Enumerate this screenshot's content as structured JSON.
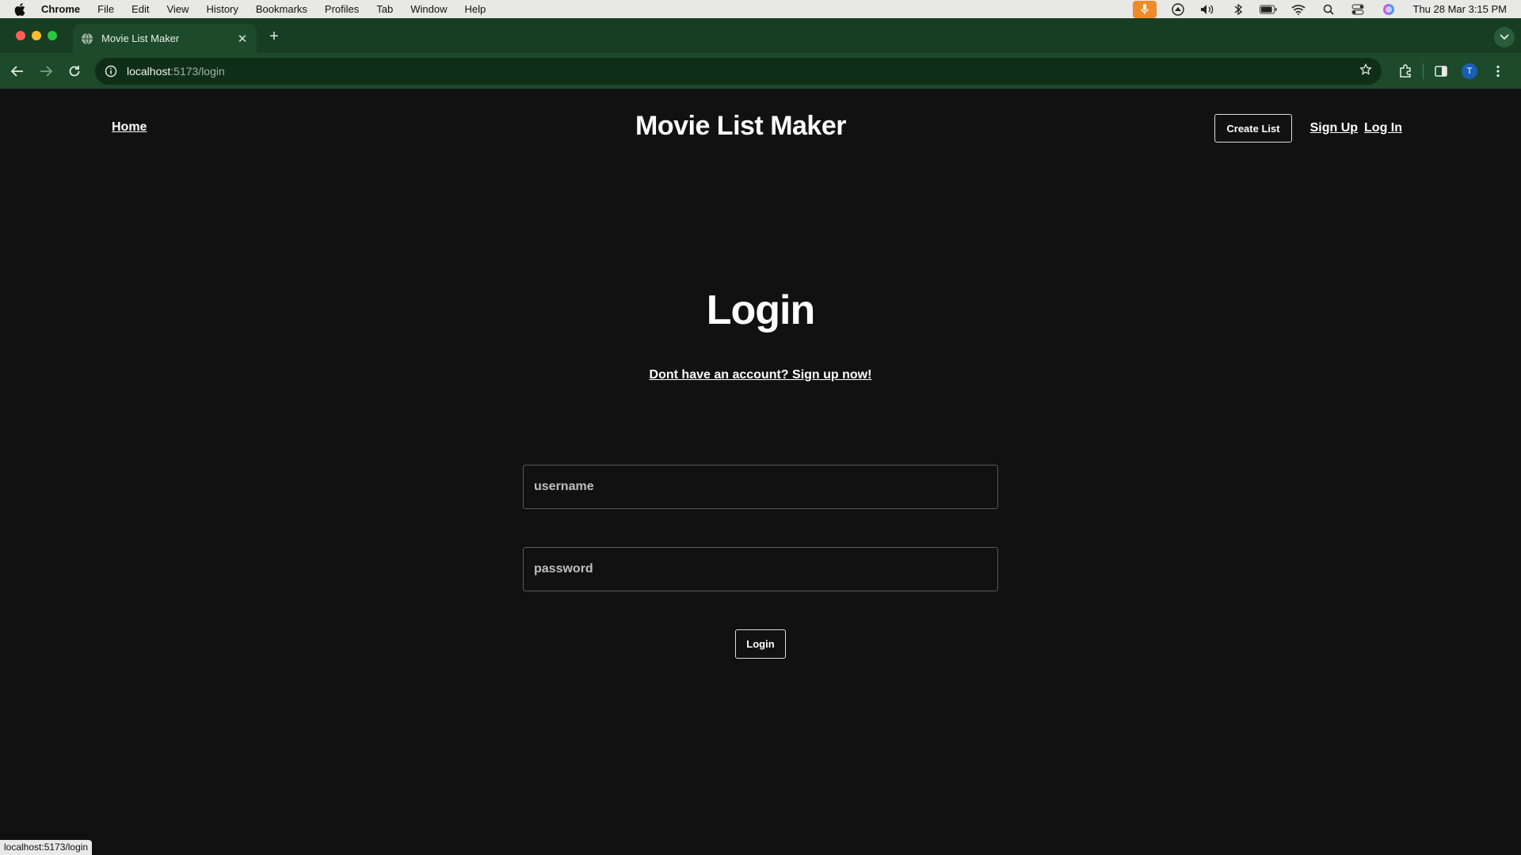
{
  "menubar": {
    "app_name": "Chrome",
    "items": [
      "File",
      "Edit",
      "View",
      "History",
      "Bookmarks",
      "Profiles",
      "Tab",
      "Window",
      "Help"
    ],
    "clock": "Thu 28 Mar  3:15 PM",
    "status_icons": [
      "microphone-icon",
      "vpn-icon",
      "volume-icon",
      "bluetooth-icon",
      "battery-icon",
      "wifi-icon",
      "search-icon",
      "control-center-icon",
      "siri-icon"
    ]
  },
  "browser": {
    "tab_title": "Movie List Maker",
    "url_host": "localhost",
    "url_path": ":5173/login",
    "profile_initial": "T",
    "status_bar_url": "localhost:5173/login"
  },
  "site": {
    "home_label": "Home",
    "title": "Movie List Maker",
    "create_list_label": "Create List",
    "sign_up_label": "Sign Up",
    "log_in_label": "Log In"
  },
  "login": {
    "heading": "Login",
    "signup_prompt": "Dont have an account? Sign up now!",
    "username_placeholder": "username",
    "password_placeholder": "password",
    "submit_label": "Login"
  },
  "colors": {
    "page_background": "#111111",
    "chrome_frame": "#173d23",
    "chrome_toolbar": "#1c4a2a",
    "mic_indicator": "#f08b2a"
  }
}
